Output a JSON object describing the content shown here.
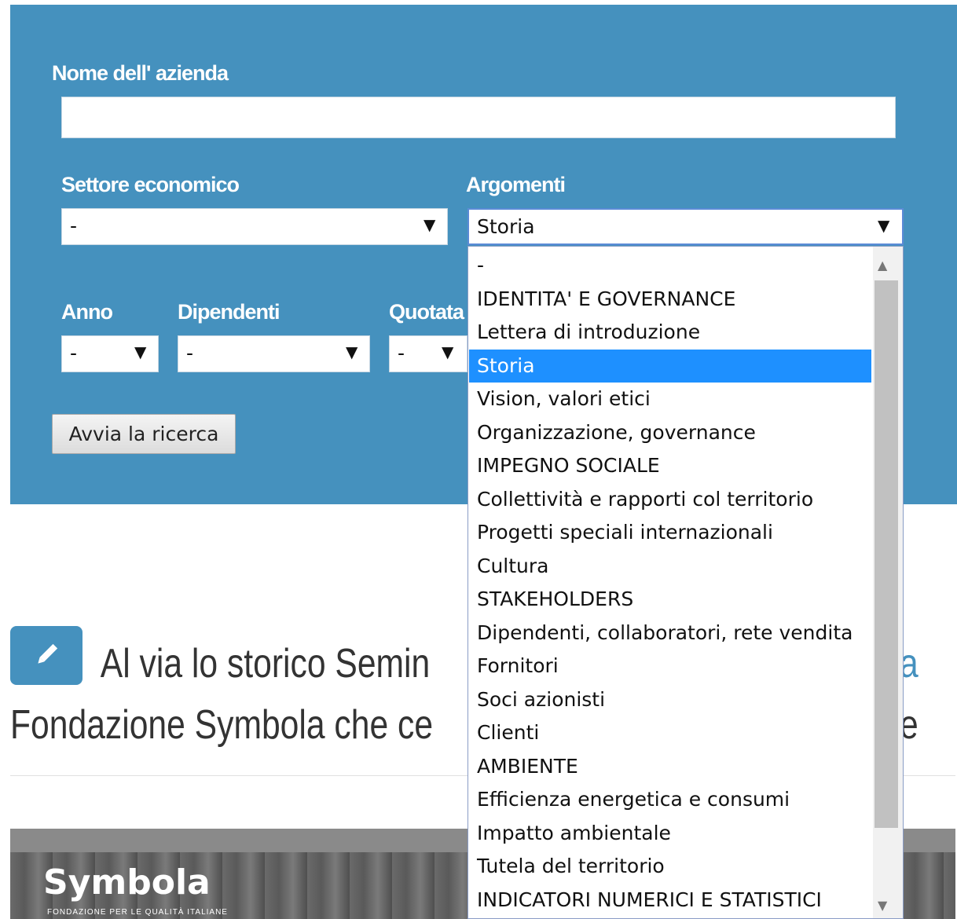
{
  "form": {
    "company_label": "Nome dell' azienda",
    "company_value": "",
    "sector_label": "Settore economico",
    "sector_value": "-",
    "topics_label": "Argomenti",
    "topics_value": "Storia",
    "year_label": "Anno",
    "year_value": "-",
    "employees_label": "Dipendenti",
    "employees_value": "-",
    "listed_label": "Quotata",
    "listed_value": "-",
    "search_button": "Avvia la ricerca",
    "dropdown_arrow": "▼"
  },
  "dropdown": {
    "options": [
      "-",
      "IDENTITA' E GOVERNANCE",
      "Lettera di introduzione",
      "Storia",
      "Vision, valori etici",
      "Organizzazione, governance",
      "IMPEGNO SOCIALE",
      "Collettività e rapporti col territorio",
      "Progetti speciali internazionali",
      "Cultura",
      "STAKEHOLDERS",
      "Dipendenti, collaboratori, rete vendita",
      "Fornitori",
      "Soci azionisti",
      "Clienti",
      "AMBIENTE",
      "Efficienza energetica e consumi",
      "Impatto ambientale",
      "Tutela del territorio",
      "INDICATORI NUMERICI E STATISTICI"
    ],
    "selected_index": 3
  },
  "article": {
    "icon": "pencil-icon",
    "title_line1": "Al via lo storico Semin",
    "title_line1_end": "a",
    "title_line2": "Fondazione Symbola che ce",
    "title_line2_end": "e"
  },
  "banner": {
    "logo_text": "Symbola",
    "logo_sub": "FONDAZIONE PER LE QUALITÀ ITALIANE"
  },
  "colors": {
    "panel": "#4591be",
    "selected_option": "#1e90ff"
  }
}
